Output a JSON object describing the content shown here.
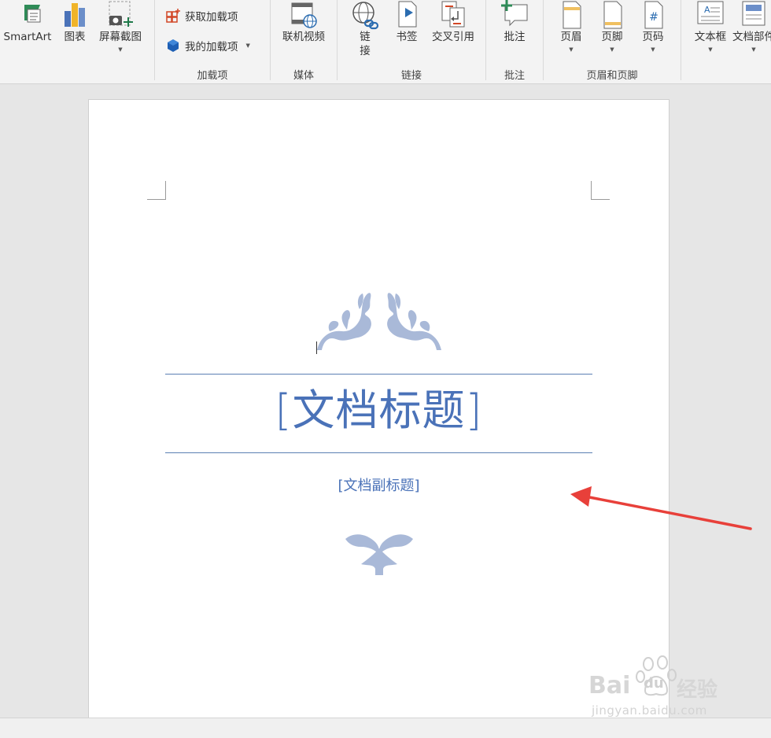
{
  "ribbon": {
    "illustrations": {
      "smartart_label": "SmartArt",
      "chart_label": "图表",
      "screenshot_label": "屏幕截图"
    },
    "addins": {
      "get_addins_label": "获取加载项",
      "my_addins_label": "我的加载项",
      "group_label": "加载项"
    },
    "media": {
      "online_video_label": "联机视频",
      "group_label": "媒体"
    },
    "links": {
      "link_label_1": "链",
      "link_label_2": "接",
      "bookmark_label": "书签",
      "cross_reference_label": "交叉引用",
      "group_label": "链接"
    },
    "comments": {
      "comment_label": "批注",
      "group_label": "批注"
    },
    "header_footer": {
      "header_label": "页眉",
      "footer_label": "页脚",
      "page_number_label": "页码",
      "group_label": "页眉和页脚"
    },
    "text": {
      "textbox_label": "文本框",
      "doc_parts_label": "文档部件"
    }
  },
  "document": {
    "title": "[文档标题]",
    "subtitle": "[文档副标题]"
  },
  "watermark": {
    "brand": "Bai",
    "brand_suffix": "经验",
    "url": "jingyan.baidu.com"
  },
  "colors": {
    "accent": "#4a72b8",
    "ornament": "#a9b9d8",
    "arrow": "#e8403a"
  }
}
